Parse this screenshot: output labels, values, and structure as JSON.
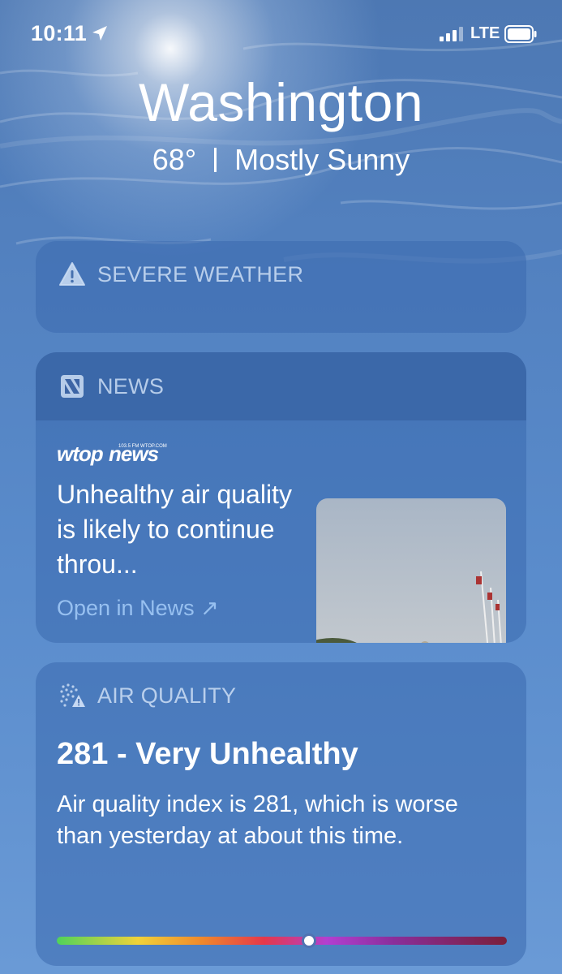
{
  "status_bar": {
    "time": "10:11",
    "network": "LTE",
    "icons": [
      "location-arrow-icon",
      "signal-icon",
      "battery-icon"
    ]
  },
  "header": {
    "city": "Washington",
    "temperature": "68°",
    "condition": "Mostly Sunny"
  },
  "severe_weather": {
    "title": "SEVERE WEATHER",
    "icon": "warning-triangle-icon"
  },
  "news": {
    "title": "NEWS",
    "icon": "apple-news-icon",
    "source": "wtopnews",
    "source_tagline": "103.5 FM WTOP.COM",
    "headline": "Unhealthy air quality is likely to continue throu...",
    "link_label": "Open in News ↗"
  },
  "air_quality": {
    "title": "AIR QUALITY",
    "icon": "air-quality-icon",
    "summary": "281 - Very Unhealthy",
    "description": "Air quality index is 281, which is worse than yesterday at about this time.",
    "index_position_fraction": 0.56
  },
  "colors": {
    "card_bg": "#3a69af",
    "link": "#a0c8f5",
    "header_text": "#cddef5"
  }
}
